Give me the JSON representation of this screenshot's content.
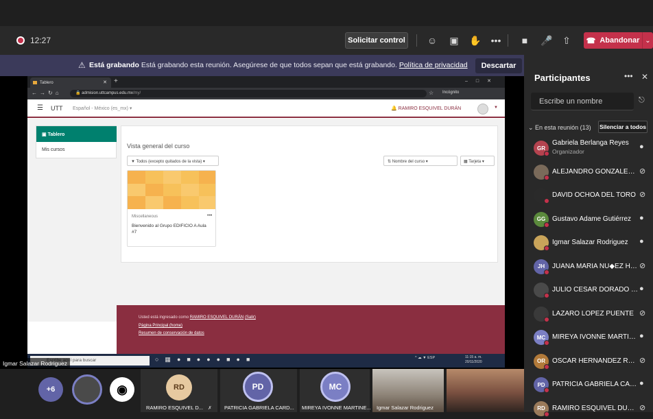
{
  "meeting": {
    "timer": "12:27",
    "request_control": "Solicitar control",
    "leave": "Abandonar",
    "toolbar_icons": [
      "participants-icon",
      "chat-icon",
      "raise-hand-icon",
      "more-icon",
      "camera-icon",
      "mic-icon",
      "share-icon"
    ]
  },
  "recording_banner": {
    "bold": "Está grabando",
    "text": " Está grabando esta reunión. Asegúrese de que todos sepan que está grabando. ",
    "link": "Política de privacidad",
    "dismiss": "Descartar"
  },
  "shared_screen": {
    "browser": {
      "tab_title": "Tablero",
      "url_host": "admision.uttcampus.edu.mx",
      "url_path": "/my/",
      "incognito": "Incógnito"
    },
    "moodle": {
      "site_name": "UTT",
      "language": "Español - México (es_mx) ▾",
      "user": "RAMIRO ESQUIVEL DURÁN",
      "nav": [
        {
          "label": "Tablero"
        },
        {
          "label": "Mis cursos"
        }
      ],
      "overview_title": "Vista general del curso",
      "filter": "Todos (excepto quitados de la vista) ▾",
      "sort": "Nombre del curso ▾",
      "view": "Tarjeta ▾",
      "course": {
        "category": "Miscellaneous",
        "name": "Bienvenido al Grupo EDIFICIO A Aula #7"
      },
      "footer": {
        "logged_prefix": "Usted está ingresado como ",
        "logged_user": "RAMIRO ESQUIVEL DURÁN",
        "logout": "(Salir)",
        "home": "Página Principal (home)",
        "retention": "Resumen de conservación de datos"
      }
    },
    "taskbar": {
      "search": "Escribe aquí para buscar",
      "tray": "ESP",
      "time": "11:15 a. m.",
      "date": "20/11/2020"
    },
    "presenter_label": "Igmar Salazar Rodriguez"
  },
  "gallery": {
    "more_count": "+6",
    "tiles": [
      {
        "initials": "RD",
        "name": "RAMIRO ESQUIVEL D..."
      },
      {
        "initials": "PD",
        "name": "PATRICIA GABRIELA CARD..."
      },
      {
        "initials": "MC",
        "name": "MIREYA IVONNE MARTINE..."
      },
      {
        "initials": "",
        "name": "Igmar Salazar Rodriguez"
      }
    ]
  },
  "participants_panel": {
    "title": "Participantes",
    "search_placeholder": "Escribe un nombre",
    "section": "In esta reunión (13)",
    "mute_all": "Silenciar a todos",
    "people": [
      {
        "initials": "GR",
        "name": "Gabriela Berlanga Reyes",
        "role": "Organizador",
        "color": "#b4434f",
        "mic": "on"
      },
      {
        "initials": "",
        "name": "ALEJANDRO GONZALEZ GON...",
        "color": "#7a6a5a",
        "mic": "off"
      },
      {
        "initials": "",
        "name": "DAVID OCHOA DEL TORO",
        "color": "#2a2a2a",
        "mic": "off"
      },
      {
        "initials": "GG",
        "name": "Gustavo Adame Gutiérrez",
        "color": "#5b8a3c",
        "mic": "on"
      },
      {
        "initials": "",
        "name": "Igmar Salazar Rodriguez",
        "color": "#c9a45a",
        "mic": "on"
      },
      {
        "initials": "JH",
        "name": "JUANA MARIA NU◆EZ HERN...",
        "color": "#6264a7",
        "mic": "off"
      },
      {
        "initials": "",
        "name": "JULIO CESAR DORADO ESPI...",
        "color": "#4a4a4a",
        "mic": "on"
      },
      {
        "initials": "",
        "name": "LAZARO LOPEZ PUENTE",
        "color": "#3a3a3a",
        "mic": "off"
      },
      {
        "initials": "MC",
        "name": "MIREYA IVONNE MARTINEZ ...",
        "color": "#7b7fc4",
        "mic": "on"
      },
      {
        "initials": "OR",
        "name": "OSCAR HERNANDEZ REYES",
        "color": "#b27a3a",
        "mic": "off"
      },
      {
        "initials": "PD",
        "name": "PATRICIA GABRIELA CARDO...",
        "color": "#6264a7",
        "mic": "on"
      },
      {
        "initials": "RD",
        "name": "RAMIRO ESQUIVEL DURAN",
        "color": "#9a7a5a",
        "mic": "off"
      }
    ]
  }
}
